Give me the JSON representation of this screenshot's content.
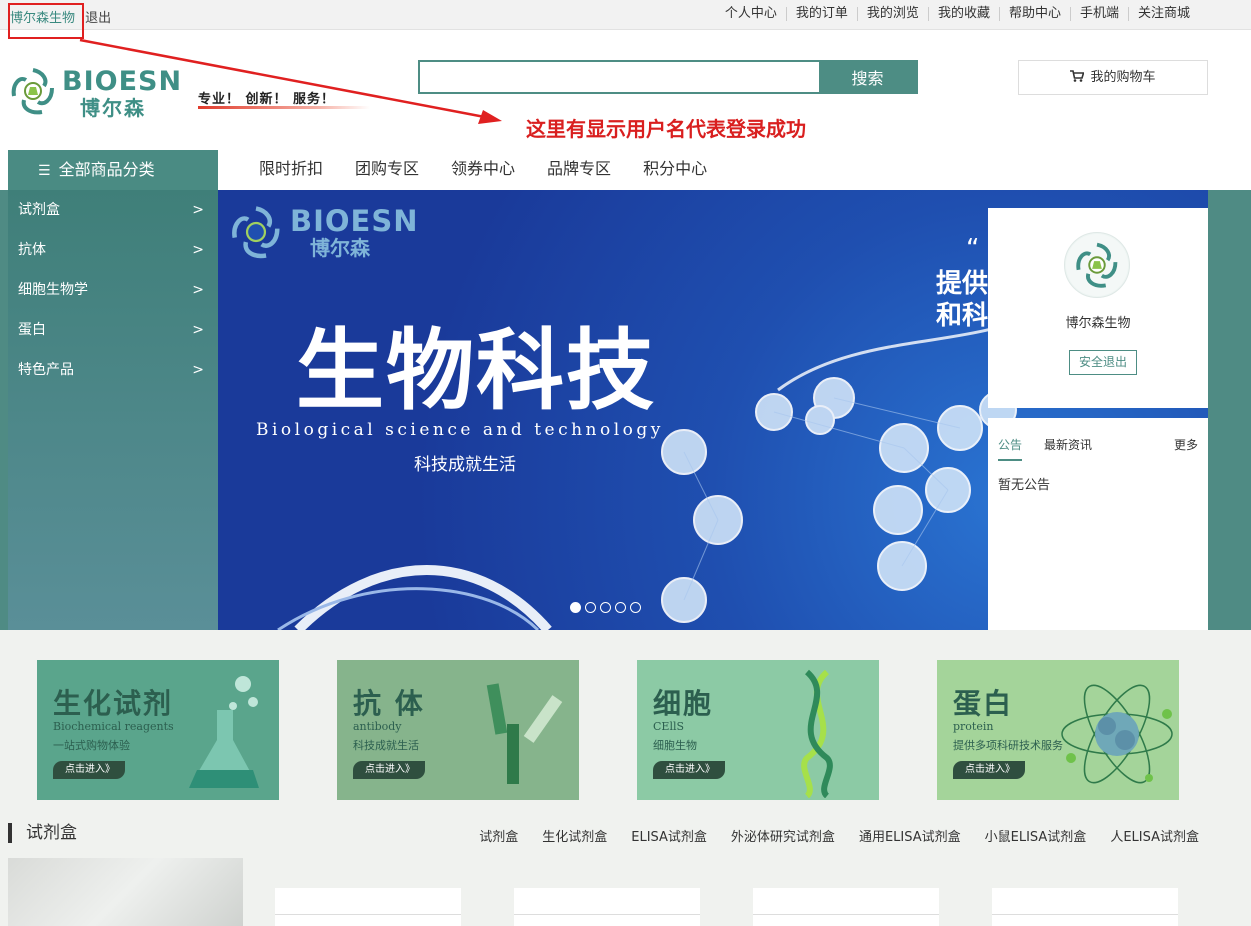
{
  "topbar": {
    "username": "博尔森生物",
    "logout": "退出",
    "links": [
      "个人中心",
      "我的订单",
      "我的浏览",
      "我的收藏",
      "帮助中心",
      "手机端",
      "关注商城"
    ]
  },
  "header": {
    "logo_en": "BIOESN",
    "logo_cn": "博尔森",
    "slogan": "专业！ 创新！ 服务！",
    "search_placeholder": "",
    "search_button": "搜索",
    "cart_label": "我的购物车"
  },
  "annotation": {
    "text": "这里有显示用户名代表登录成功",
    "color": "#d91f1f"
  },
  "nav": {
    "all_categories": "全部商品分类",
    "links": [
      "限时折扣",
      "团购专区",
      "领券中心",
      "品牌专区",
      "积分中心"
    ]
  },
  "category_menu": [
    "试剂盒",
    "抗体",
    "细胞生物学",
    "蛋白",
    "特色产品"
  ],
  "banner": {
    "logo_en": "BIOESN",
    "logo_cn": "博尔森",
    "title": "生物科技",
    "subtitle_en": "Biological science and technology",
    "subtitle_cn": "科技成就生活",
    "side_quote": "“",
    "side_text_1": "提供",
    "side_text_2": "和科",
    "slides": 5,
    "active_slide": 1
  },
  "user_panel": {
    "name": "博尔森生物",
    "exit_button": "安全退出"
  },
  "notice_panel": {
    "tabs": [
      "公告",
      "最新资讯"
    ],
    "more": "更多",
    "empty_text": "暂无公告"
  },
  "promo_cards": [
    {
      "title": "生化试剂",
      "en": "Biochemical reagents",
      "sub": "一站式购物体验",
      "button": "点击进入》",
      "color": "#5aa58c"
    },
    {
      "title": "抗 体",
      "en": "antibody",
      "sub": "科技成就生活",
      "button": "点击进入》",
      "color": "#86b48c"
    },
    {
      "title": "细胞",
      "en": "CEllS",
      "sub": "细胞生物",
      "button": "点击进入》",
      "color": "#8ccaa5"
    },
    {
      "title": "蛋白",
      "en": "protein",
      "sub": "提供多项科研技术服务",
      "button": "点击进入》",
      "color": "#a4d49a"
    }
  ],
  "section": {
    "title": "试剂盒",
    "links": [
      "试剂盒",
      "生化试剂盒",
      "ELISA试剂盒",
      "外泌体研究试剂盒",
      "通用ELISA试剂盒",
      "小鼠ELISA试剂盒",
      "人ELISA试剂盒"
    ]
  },
  "colors": {
    "brand": "#4a8b83",
    "banner_blue": "#1f4fb0",
    "accent_red": "#e02020"
  }
}
